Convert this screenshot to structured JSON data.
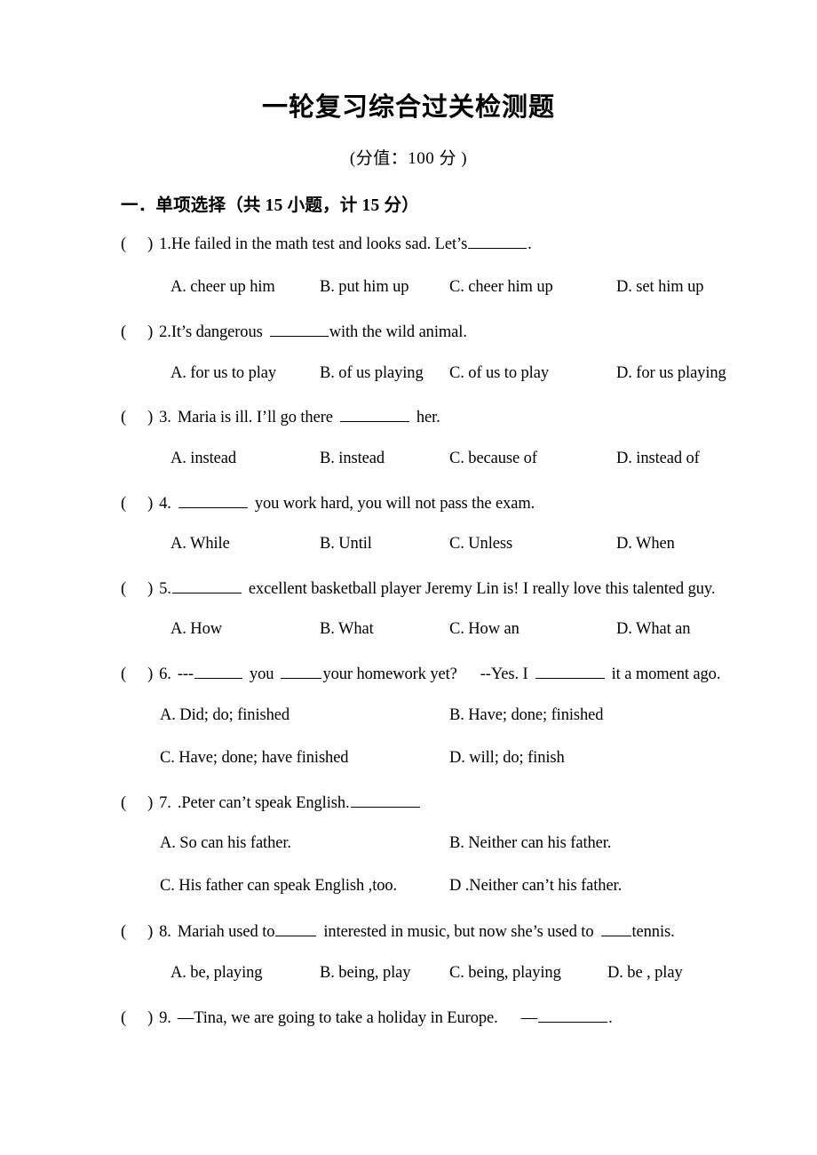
{
  "document": {
    "title": "一轮复习综合过关检测题",
    "subtitle": "(分值：100 分    )",
    "section_heading": "一．单项选择（共 15 小题，计 15 分）"
  },
  "questions": [
    {
      "marker_open": "(",
      "marker_close": ")",
      "number": "1.",
      "stem_before": "He failed in the math test and looks sad. Let’s",
      "stem_after": ".",
      "layout": "four-column",
      "options": [
        "A. cheer up him",
        "B. put him up",
        "C. cheer him up",
        "D. set him up"
      ]
    },
    {
      "marker_open": "(",
      "marker_close": ")",
      "number": "2.",
      "stem_before": "It’s dangerous",
      "stem_after": "with the wild animal.",
      "layout": "four-column",
      "options": [
        "A. for us to play",
        "B. of us playing",
        "C. of us to play",
        "D. for us playing"
      ]
    },
    {
      "marker_open": "(",
      "marker_close": ")",
      "number": "3.",
      "stem_before": "Maria is ill. I’ll go there",
      "stem_after": "her.",
      "layout": "four-column",
      "options": [
        "A. instead",
        "B. instead",
        "C. because of",
        "D. instead of"
      ]
    },
    {
      "marker_open": "(",
      "marker_close": ")",
      "number": "4.",
      "stem_before": "",
      "stem_after": "you work hard, you will not pass the exam.",
      "layout": "four-column",
      "options": [
        "A. While",
        "B. Until",
        "C. Unless",
        "D. When"
      ]
    },
    {
      "marker_open": "(",
      "marker_close": ")",
      "number": "5.",
      "stem_before": "",
      "stem_after": "excellent basketball player Jeremy Lin is! I really love this talented guy.",
      "layout": "four-column",
      "options": [
        "A. How",
        "B. What",
        "C. How an",
        "D. What an"
      ]
    },
    {
      "marker_open": "(",
      "marker_close": ")",
      "number": "6.",
      "stem_part1": "---",
      "stem_part2": "you",
      "stem_part3": "your homework yet?",
      "stem_part4": "--Yes. I",
      "stem_part5": "it a moment ago.",
      "layout": "two-column",
      "options": [
        "A. Did; do; finished",
        "B. Have; done; finished",
        "C. Have; done; have finished",
        "D. will; do; finish"
      ]
    },
    {
      "marker_open": "(",
      "marker_close": ")",
      "number": "7.",
      "stem_before": ".Peter can’t speak English.",
      "stem_after": "",
      "layout": "two-column",
      "options": [
        "A. So can his father.",
        "B. Neither can his father.",
        "C. His father can speak English ,too.",
        "D .Neither can’t his father."
      ]
    },
    {
      "marker_open": "(",
      "marker_close": ")",
      "number": "8.",
      "stem_part1": "Mariah used to",
      "stem_part2": "interested in music, but now she’s used to",
      "stem_part3": "tennis.",
      "layout": "four-column-narrow",
      "options": [
        "A. be, playing",
        "B. being, play",
        "C. being, playing",
        "D. be , play"
      ]
    },
    {
      "marker_open": "(",
      "marker_close": ")",
      "number": "9.",
      "stem_before": "—Tina, we are going to take a holiday in Europe.",
      "stem_dash": "—",
      "stem_after": ".",
      "layout": "none",
      "options": []
    }
  ]
}
